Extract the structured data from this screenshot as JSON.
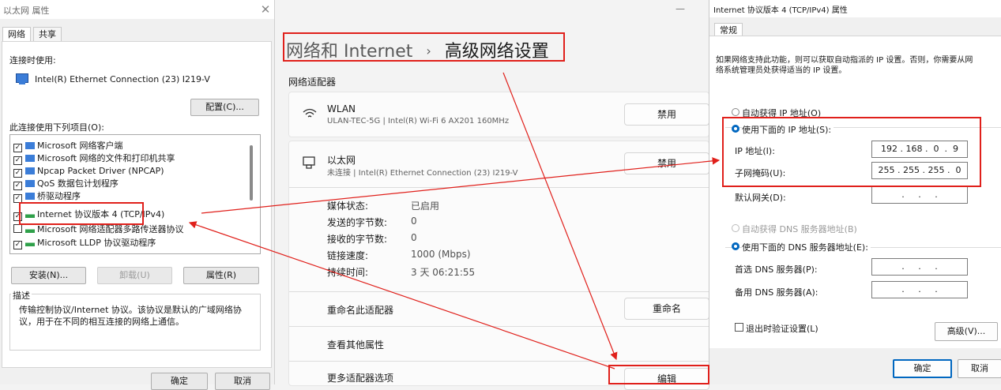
{
  "eth_dialog": {
    "title": "以太网 属性",
    "close_glyph": "✕",
    "tabs": [
      "网络",
      "共享"
    ],
    "connect_using_label": "连接时使用:",
    "adapter_name": "Intel(R) Ethernet Connection (23) I219-V",
    "configure_button": "配置(C)...",
    "items_label": "此连接使用下列项目(O):",
    "items": [
      {
        "label": "Microsoft 网络客户端",
        "checked": true,
        "icon": "network-service-icon"
      },
      {
        "label": "Microsoft 网络的文件和打印机共享",
        "checked": true,
        "icon": "network-service-icon"
      },
      {
        "label": "Npcap Packet Driver (NPCAP)",
        "checked": true,
        "icon": "network-service-icon"
      },
      {
        "label": "QoS 数据包计划程序",
        "checked": true,
        "icon": "network-service-icon"
      },
      {
        "label": "桥驱动程序",
        "checked": true,
        "icon": "network-service-icon"
      },
      {
        "label": "Internet 协议版本 4 (TCP/IPv4)",
        "checked": true,
        "icon": "protocol-icon"
      },
      {
        "label": "Microsoft 网络适配器多路传送器协议",
        "checked": false,
        "icon": "protocol-icon"
      },
      {
        "label": "Microsoft LLDP 协议驱动程序",
        "checked": true,
        "icon": "protocol-icon"
      }
    ],
    "install_button": "安装(N)...",
    "uninstall_button": "卸载(U)",
    "properties_button": "属性(R)",
    "description_label": "描述",
    "description_text": "传输控制协议/Internet 协议。该协议是默认的广域网络协议，用于在不同的相互连接的网络上通信。",
    "ok_button": "确定",
    "cancel_button": "取消"
  },
  "settings": {
    "minimize_glyph": "—",
    "breadcrumb_parent": "网络和 Internet",
    "breadcrumb_sep": "›",
    "breadcrumb_current": "高级网络设置",
    "section_label": "网络适配器",
    "wlan": {
      "name": "WLAN",
      "desc": "ULAN-TEC-5G | Intel(R) Wi-Fi 6 AX201 160MHz",
      "button": "禁用"
    },
    "ethernet": {
      "name": "以太网",
      "desc": "未连接 | Intel(R) Ethernet Connection (23) I219-V",
      "button": "禁用"
    },
    "details": [
      {
        "label": "媒体状态:",
        "value": "已启用"
      },
      {
        "label": "发送的字节数:",
        "value": "0"
      },
      {
        "label": "接收的字节数:",
        "value": "0"
      },
      {
        "label": "链接速度:",
        "value": "1000 (Mbps)"
      },
      {
        "label": "持续时间:",
        "value": "3 天 06:21:55"
      }
    ],
    "rename_label": "重命名此适配器",
    "rename_button": "重命名",
    "view_props_label": "查看其他属性",
    "more_options_label": "更多适配器选项",
    "edit_button": "编辑"
  },
  "ipv4": {
    "title": "Internet 协议版本 4 (TCP/IPv4) 属性",
    "tab": "常规",
    "info_text_1": "如果网络支持此功能，则可以获取自动指派的 IP 设置。否则，你需要从网",
    "info_text_2": "络系统管理员处获得适当的 IP 设置。",
    "auto_ip_label": "自动获得 IP 地址(O)",
    "manual_ip_label": "使用下面的 IP 地址(S):",
    "ip_label": "IP 地址(I):",
    "ip_value": "192 . 168 .  0  .  9",
    "mask_label": "子网掩码(U):",
    "mask_value": "255 . 255 . 255 .  0",
    "gateway_label": "默认网关(D):",
    "gateway_value": " .     .     . ",
    "auto_dns_label": "自动获得 DNS 服务器地址(B)",
    "manual_dns_label": "使用下面的 DNS 服务器地址(E):",
    "pref_dns_label": "首选 DNS 服务器(P):",
    "pref_dns_value": " .     .     . ",
    "alt_dns_label": "备用 DNS 服务器(A):",
    "alt_dns_value": " .     .     . ",
    "validate_label": "退出时验证设置(L)",
    "advanced_button": "高级(V)...",
    "ok_button": "确定",
    "cancel_button": "取消"
  },
  "colors": {
    "annotation_red": "#e0201b",
    "accent": "#0067c0"
  }
}
